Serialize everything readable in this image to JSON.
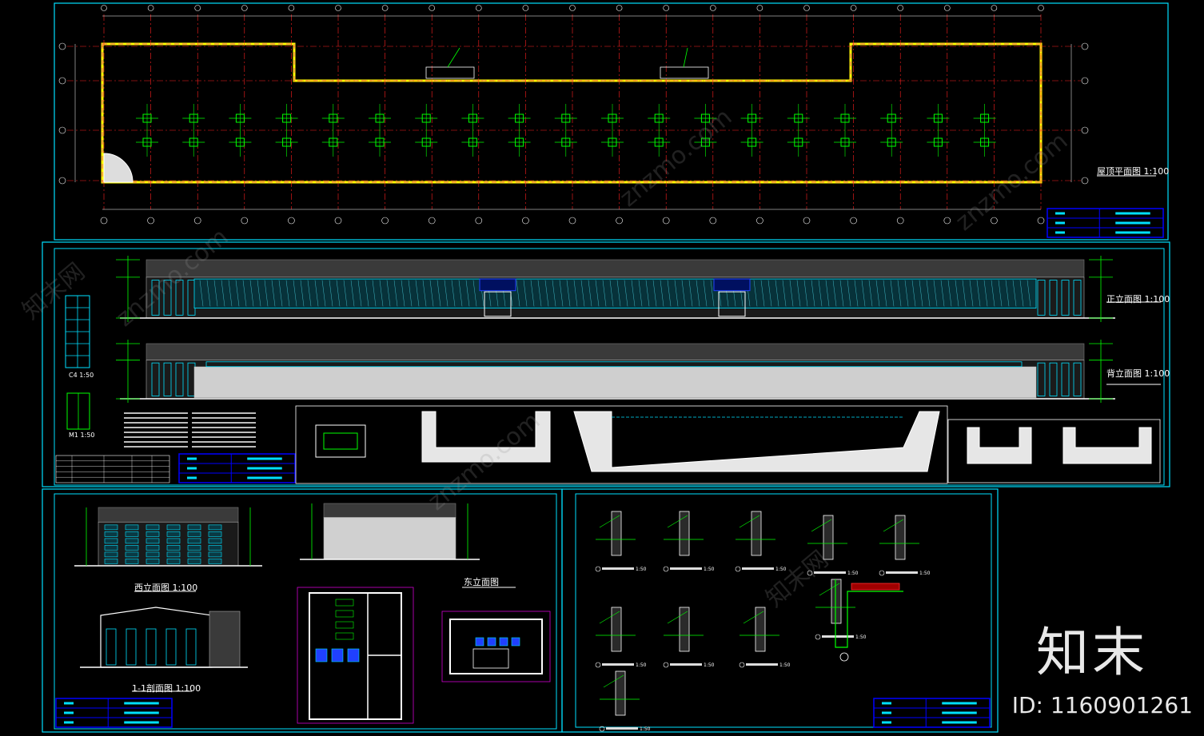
{
  "sheet": {
    "plan_title": "屋顶平面图",
    "plan_scale": "1:100",
    "front_title": "正立面图",
    "front_scale": "1:100",
    "back_title": "背立面图",
    "back_scale": "1:100",
    "west_title": "西立面图",
    "west_scale": "1:100",
    "east_title": "东立面图",
    "section_title": "1-1剖面图",
    "section_scale": "1:100",
    "window_detail": "C4 1:50",
    "door_detail": "M1 1:50"
  },
  "detail_labels": [
    "1:50",
    "1:50",
    "1:50",
    "1:50",
    "1:50",
    "1:50",
    "1:50",
    "1:50",
    "1:50",
    "1:50"
  ],
  "watermark": {
    "logo": "知末",
    "id": "ID: 1160901261",
    "diagonal": "znzmo.com",
    "diagonal_cn": "知末网"
  },
  "colors": {
    "background": "#000000",
    "frame": "#00e0ff",
    "structure": "#00ff00",
    "axis": "#ff2020",
    "wall": "#ffff00",
    "title_block": "#0000ff",
    "text": "#ffffff"
  }
}
